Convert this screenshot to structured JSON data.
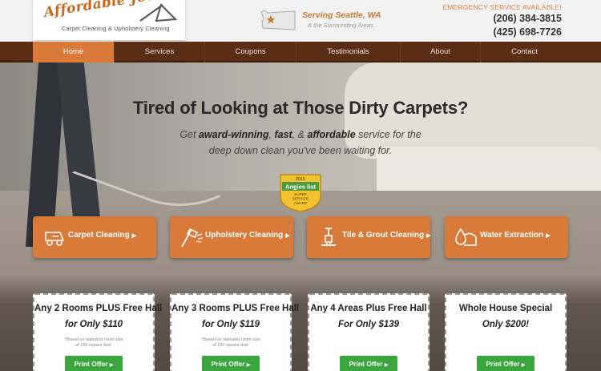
{
  "header": {
    "logo_name": "Affordable Joe's",
    "logo_tagline": "Carpet Cleaning & Upholstery Cleaning",
    "serving": "Serving Seattle, WA",
    "areas": "& the Surrounding Areas",
    "emergency": "EMERGENCY SERVICE AVAILABLE!",
    "phone1": "(206) 384-3815",
    "phone2": "(425) 698-7726"
  },
  "nav": {
    "items": [
      {
        "label": "Home",
        "active": true
      },
      {
        "label": "Services",
        "active": false
      },
      {
        "label": "Coupons",
        "active": false
      },
      {
        "label": "Testimonials",
        "active": false
      },
      {
        "label": "About",
        "active": false
      },
      {
        "label": "Contact",
        "active": false
      }
    ]
  },
  "hero": {
    "title": "Tired of Looking at Those Dirty Carpets?",
    "sub_get": "Get",
    "sub_award": "award-winning",
    "sub_comma": ",",
    "sub_fast": "fast",
    "sub_amp": ", &",
    "sub_affordable": "affordable",
    "sub_tail": "service for the",
    "sub_line2": "deep down clean you've been waiting for.",
    "badge": {
      "year": "2015",
      "brand": "Angies list",
      "line1": "SUPER",
      "line2": "SERVICE",
      "line3": "AWARD"
    }
  },
  "services": [
    {
      "label": "Carpet Cleaning",
      "icon": "carpet-machine-icon"
    },
    {
      "label": "Upholstery Cleaning",
      "icon": "upholstery-wand-icon"
    },
    {
      "label": "Tile & Grout Cleaning",
      "icon": "tile-tool-icon"
    },
    {
      "label": "Water Extraction",
      "icon": "water-drop-icon"
    }
  ],
  "coupons": [
    {
      "title": "Any 2 Rooms PLUS Free Hall",
      "price": "for Only $110",
      "note1": "*Based on standard room size",
      "note2": "of 150 square feet.",
      "button": "Print Offer"
    },
    {
      "title": "Any 3 Rooms PLUS Free Hall",
      "price": "for Only $119",
      "note1": "*Based on standard room size",
      "note2": "of 150 square feet.",
      "button": "Print Offer"
    },
    {
      "title": "Any 4 Areas Plus Free Hall",
      "price": "For Only $139",
      "note1": "",
      "note2": "",
      "button": "Print Offer"
    },
    {
      "title": "Whole House Special",
      "price": "Only $200!",
      "note1": "",
      "note2": "",
      "button": "Print Offer"
    }
  ],
  "colors": {
    "accent_orange": "#d77a3a",
    "nav_brown": "#5a2d15",
    "print_green": "#3aa63d"
  }
}
